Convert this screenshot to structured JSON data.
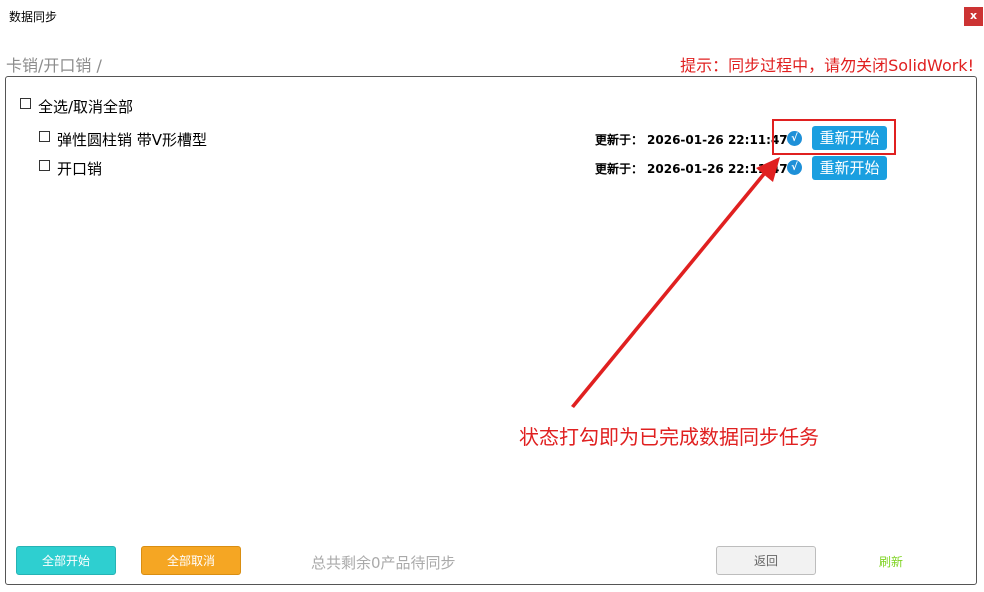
{
  "window": {
    "title": "数据同步",
    "close_label": "x"
  },
  "breadcrumb": "卡销/开口销 /",
  "hint": "提示：同步过程中，请勿关闭SolidWork!",
  "select_all_label": "全选/取消全部",
  "items": [
    {
      "name": "弹性圆柱销 带V形槽型",
      "updated_label": "更新于：",
      "updated_at": "2026-01-26 22:11:47",
      "status_icon": "√",
      "restart_label": "重新开始"
    },
    {
      "name": "开口销",
      "updated_label": "更新于：",
      "updated_at": "2026-01-26 22:11:47",
      "status_icon": "√",
      "restart_label": "重新开始"
    }
  ],
  "annotation": "状态打勾即为已完成数据同步任务",
  "footer": {
    "start_all": "全部开始",
    "cancel_all": "全部取消",
    "summary": "总共剩余0产品待同步",
    "back": "返回",
    "refresh": "刷新"
  },
  "colors": {
    "accent_blue": "#1a9fe0",
    "warning_red": "#e02020",
    "start_teal": "#2ecfd0",
    "cancel_orange": "#f5a623",
    "refresh_green": "#7ed321"
  }
}
